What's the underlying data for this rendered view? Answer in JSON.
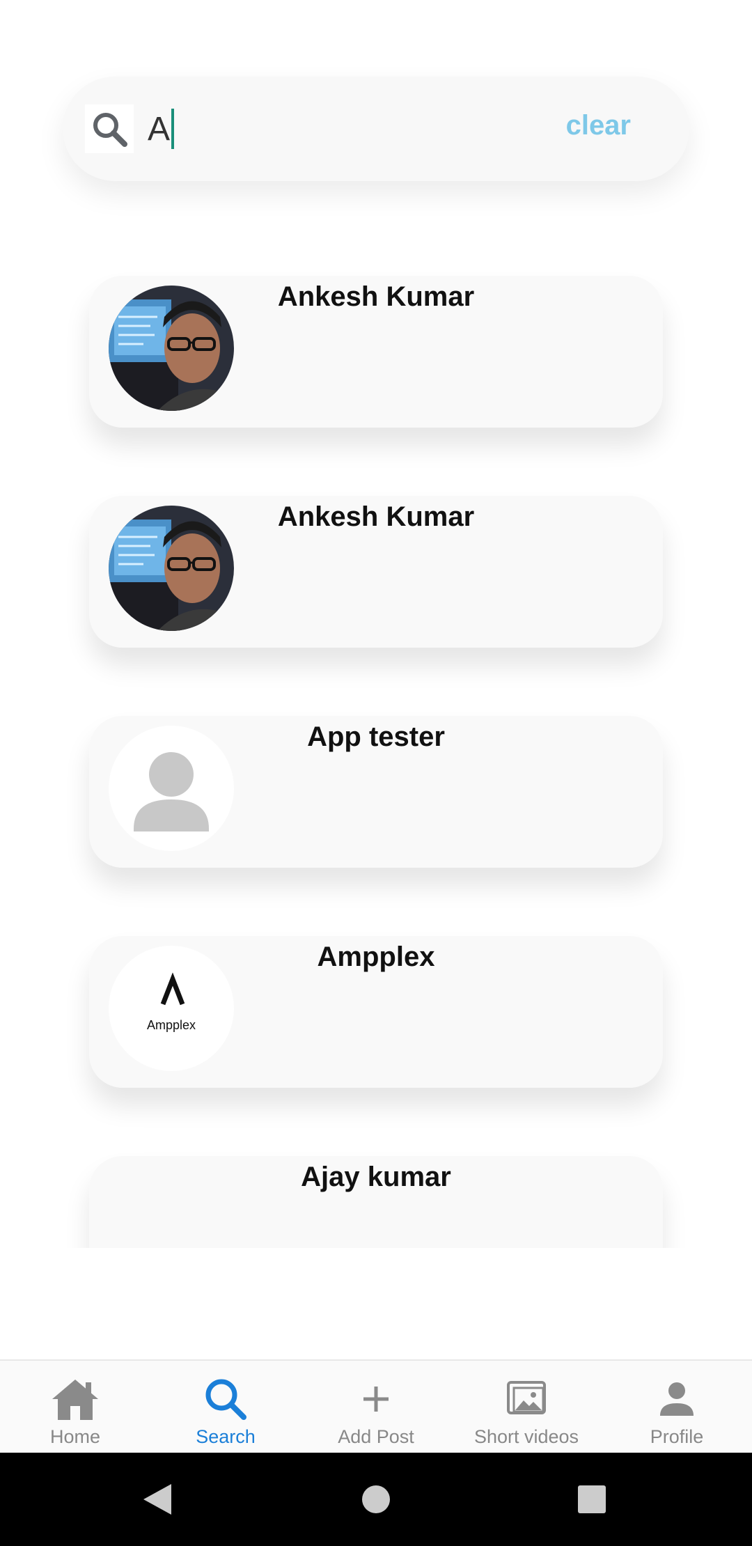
{
  "search": {
    "value": "A",
    "clear_label": "clear"
  },
  "results": [
    {
      "name": "Ankesh Kumar",
      "avatar": "photo"
    },
    {
      "name": "Ankesh Kumar",
      "avatar": "photo"
    },
    {
      "name": "App tester",
      "avatar": "default-person"
    },
    {
      "name": "Ampplex",
      "avatar": "ampplex-logo",
      "logo_text": "Ampplex"
    },
    {
      "name": "Ajay kumar",
      "avatar": "none"
    }
  ],
  "nav": {
    "items": [
      {
        "label": "Home",
        "icon": "home-icon"
      },
      {
        "label": "Search",
        "icon": "search-icon",
        "active": true
      },
      {
        "label": "Add Post",
        "icon": "plus-icon"
      },
      {
        "label": "Short videos",
        "icon": "image-icon"
      },
      {
        "label": "Profile",
        "icon": "person-icon"
      }
    ]
  },
  "colors": {
    "accent": "#1b7fd8",
    "clear": "#7ec8e8",
    "cursor": "#1a8f7a"
  }
}
